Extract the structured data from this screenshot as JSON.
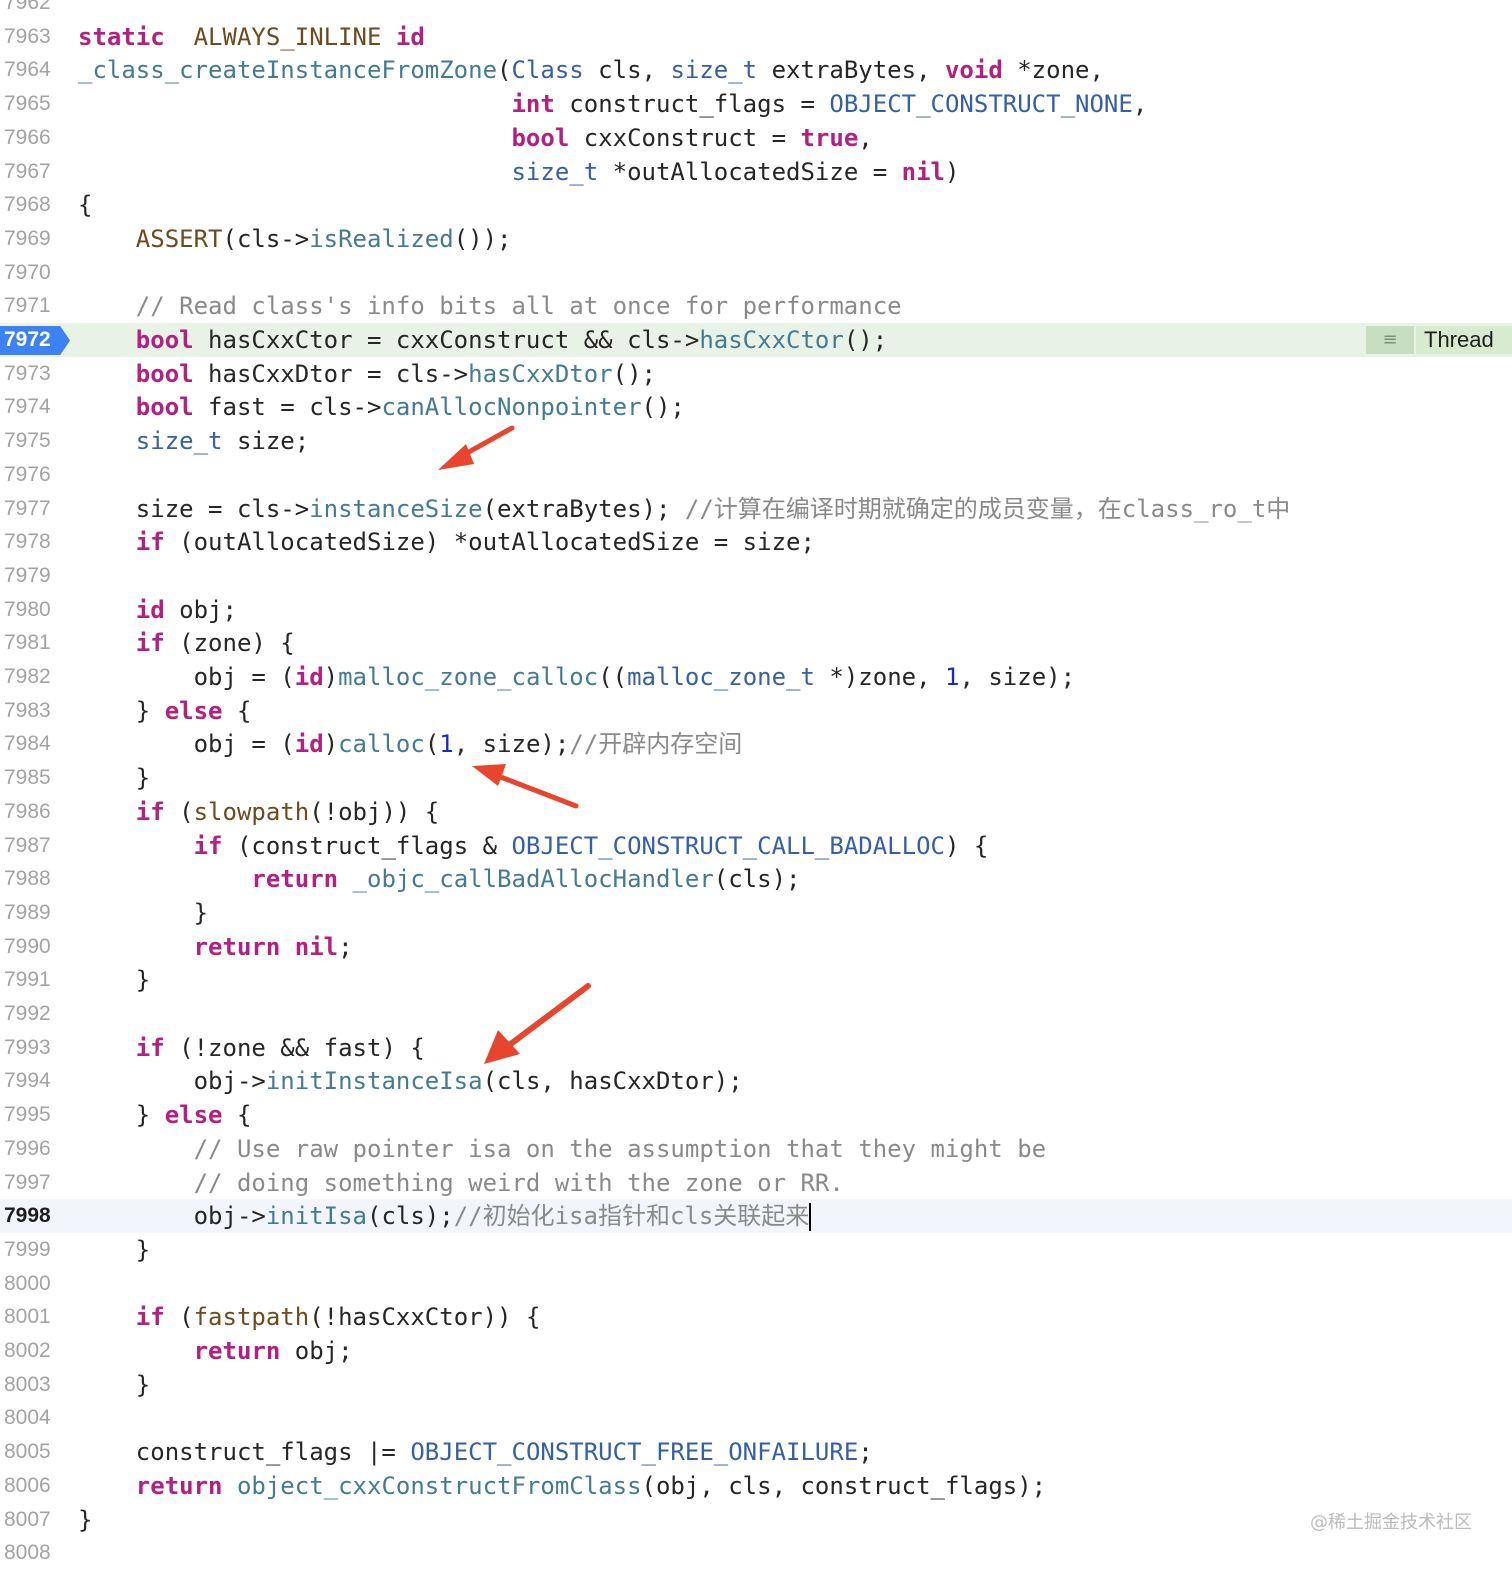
{
  "editor": {
    "lines": [
      {
        "num": "7962",
        "tokens": []
      },
      {
        "num": "7963",
        "tokens": [
          [
            "k",
            "static"
          ],
          [
            "",
            "  "
          ],
          [
            "m",
            "ALWAYS_INLINE"
          ],
          [
            "",
            ""
          ],
          [
            "k",
            " id"
          ]
        ]
      },
      {
        "num": "7964",
        "tokens": [
          [
            "f",
            "_class_createInstanceFromZone"
          ],
          [
            "",
            "("
          ],
          [
            "t",
            "Class"
          ],
          [
            "",
            " cls, "
          ],
          [
            "t",
            "size_t"
          ],
          [
            "",
            " extraBytes, "
          ],
          [
            "k",
            "void"
          ],
          [
            "",
            " *zone,"
          ]
        ]
      },
      {
        "num": "7965",
        "tokens": [
          [
            "",
            "                              "
          ],
          [
            "k",
            "int"
          ],
          [
            "",
            " construct_flags = "
          ],
          [
            "t",
            "OBJECT_CONSTRUCT_NONE"
          ],
          [
            "",
            ","
          ]
        ]
      },
      {
        "num": "7966",
        "tokens": [
          [
            "",
            "                              "
          ],
          [
            "k",
            "bool"
          ],
          [
            "",
            " cxxConstruct = "
          ],
          [
            "k",
            "true"
          ],
          [
            "",
            ","
          ]
        ]
      },
      {
        "num": "7967",
        "tokens": [
          [
            "",
            "                              "
          ],
          [
            "t",
            "size_t"
          ],
          [
            "",
            " *outAllocatedSize = "
          ],
          [
            "k",
            "nil"
          ],
          [
            "",
            ")"
          ]
        ]
      },
      {
        "num": "7968",
        "tokens": [
          [
            "",
            "{"
          ]
        ]
      },
      {
        "num": "7969",
        "tokens": [
          [
            "",
            "    "
          ],
          [
            "m",
            "ASSERT"
          ],
          [
            "",
            "(cls->"
          ],
          [
            "f",
            "isRealized"
          ],
          [
            "",
            "());"
          ]
        ]
      },
      {
        "num": "7970",
        "tokens": []
      },
      {
        "num": "7971",
        "tokens": [
          [
            "",
            "    "
          ],
          [
            "c",
            "// Read class's info bits all at once for performance"
          ]
        ]
      },
      {
        "num": "7972",
        "tokens": [
          [
            "",
            "    "
          ],
          [
            "k",
            "bool"
          ],
          [
            "",
            " hasCxxCtor = cxxConstruct && cls->"
          ],
          [
            "f",
            "hasCxxCtor"
          ],
          [
            "",
            "();"
          ]
        ]
      },
      {
        "num": "7973",
        "tokens": [
          [
            "",
            "    "
          ],
          [
            "k",
            "bool"
          ],
          [
            "",
            " hasCxxDtor = cls->"
          ],
          [
            "f",
            "hasCxxDtor"
          ],
          [
            "",
            "();"
          ]
        ]
      },
      {
        "num": "7974",
        "tokens": [
          [
            "",
            "    "
          ],
          [
            "k",
            "bool"
          ],
          [
            "",
            " fast = cls->"
          ],
          [
            "f",
            "canAllocNonpointer"
          ],
          [
            "",
            "();"
          ]
        ]
      },
      {
        "num": "7975",
        "tokens": [
          [
            "",
            "    "
          ],
          [
            "t",
            "size_t"
          ],
          [
            "",
            " size;"
          ]
        ]
      },
      {
        "num": "7976",
        "tokens": []
      },
      {
        "num": "7977",
        "tokens": [
          [
            "",
            "    size = cls->"
          ],
          [
            "f",
            "instanceSize"
          ],
          [
            "",
            "(extraBytes); "
          ],
          [
            "c",
            "//计算在编译时期就确定的成员变量，在class_ro_t中"
          ]
        ]
      },
      {
        "num": "7978",
        "tokens": [
          [
            "",
            "    "
          ],
          [
            "k",
            "if"
          ],
          [
            "",
            " (outAllocatedSize) *outAllocatedSize = size;"
          ]
        ]
      },
      {
        "num": "7979",
        "tokens": []
      },
      {
        "num": "7980",
        "tokens": [
          [
            "",
            "    "
          ],
          [
            "k",
            "id"
          ],
          [
            "",
            " obj;"
          ]
        ]
      },
      {
        "num": "7981",
        "tokens": [
          [
            "",
            "    "
          ],
          [
            "k",
            "if"
          ],
          [
            "",
            " (zone) {"
          ]
        ]
      },
      {
        "num": "7982",
        "tokens": [
          [
            "",
            "        obj = ("
          ],
          [
            "k",
            "id"
          ],
          [
            "",
            ")"
          ],
          [
            "f",
            "malloc_zone_calloc"
          ],
          [
            "",
            "(("
          ],
          [
            "t",
            "malloc_zone_t"
          ],
          [
            "",
            " *)zone, "
          ],
          [
            "n",
            "1"
          ],
          [
            "",
            ", size);"
          ]
        ]
      },
      {
        "num": "7983",
        "tokens": [
          [
            "",
            "    } "
          ],
          [
            "k",
            "else"
          ],
          [
            "",
            " {"
          ]
        ]
      },
      {
        "num": "7984",
        "tokens": [
          [
            "",
            "        obj = ("
          ],
          [
            "k",
            "id"
          ],
          [
            "",
            ")"
          ],
          [
            "f",
            "calloc"
          ],
          [
            "",
            "("
          ],
          [
            "n",
            "1"
          ],
          [
            "",
            ", size);"
          ],
          [
            "c",
            "//开辟内存空间"
          ]
        ]
      },
      {
        "num": "7985",
        "tokens": [
          [
            "",
            "    }"
          ]
        ]
      },
      {
        "num": "7986",
        "tokens": [
          [
            "",
            "    "
          ],
          [
            "k",
            "if"
          ],
          [
            "",
            " ("
          ],
          [
            "m",
            "slowpath"
          ],
          [
            "",
            "(!obj)) {"
          ]
        ]
      },
      {
        "num": "7987",
        "tokens": [
          [
            "",
            "        "
          ],
          [
            "k",
            "if"
          ],
          [
            "",
            " (construct_flags & "
          ],
          [
            "t",
            "OBJECT_CONSTRUCT_CALL_BADALLOC"
          ],
          [
            "",
            ") {"
          ]
        ]
      },
      {
        "num": "7988",
        "tokens": [
          [
            "",
            "            "
          ],
          [
            "k",
            "return"
          ],
          [
            "",
            " "
          ],
          [
            "f",
            "_objc_callBadAllocHandler"
          ],
          [
            "",
            "(cls);"
          ]
        ]
      },
      {
        "num": "7989",
        "tokens": [
          [
            "",
            "        }"
          ]
        ]
      },
      {
        "num": "7990",
        "tokens": [
          [
            "",
            "        "
          ],
          [
            "k",
            "return"
          ],
          [
            "",
            " "
          ],
          [
            "k",
            "nil"
          ],
          [
            "",
            ";"
          ]
        ]
      },
      {
        "num": "7991",
        "tokens": [
          [
            "",
            "    }"
          ]
        ]
      },
      {
        "num": "7992",
        "tokens": []
      },
      {
        "num": "7993",
        "tokens": [
          [
            "",
            "    "
          ],
          [
            "k",
            "if"
          ],
          [
            "",
            " (!zone && fast) {"
          ]
        ]
      },
      {
        "num": "7994",
        "tokens": [
          [
            "",
            "        obj->"
          ],
          [
            "f",
            "initInstanceIsa"
          ],
          [
            "",
            "(cls, hasCxxDtor);"
          ]
        ]
      },
      {
        "num": "7995",
        "tokens": [
          [
            "",
            "    } "
          ],
          [
            "k",
            "else"
          ],
          [
            "",
            " {"
          ]
        ]
      },
      {
        "num": "7996",
        "tokens": [
          [
            "",
            "        "
          ],
          [
            "c",
            "// Use raw pointer isa on the assumption that they might be"
          ]
        ]
      },
      {
        "num": "7997",
        "tokens": [
          [
            "",
            "        "
          ],
          [
            "c",
            "// doing something weird with the zone or RR."
          ]
        ]
      },
      {
        "num": "7998",
        "tokens": [
          [
            "",
            "        obj->"
          ],
          [
            "f",
            "initIsa"
          ],
          [
            "",
            "(cls);"
          ],
          [
            "c",
            "//初始化isa指针和cls关联起来"
          ]
        ]
      },
      {
        "num": "7999",
        "tokens": [
          [
            "",
            "    }"
          ]
        ]
      },
      {
        "num": "8000",
        "tokens": []
      },
      {
        "num": "8001",
        "tokens": [
          [
            "",
            "    "
          ],
          [
            "k",
            "if"
          ],
          [
            "",
            " ("
          ],
          [
            "m",
            "fastpath"
          ],
          [
            "",
            "(!hasCxxCtor)) {"
          ]
        ]
      },
      {
        "num": "8002",
        "tokens": [
          [
            "",
            "        "
          ],
          [
            "k",
            "return"
          ],
          [
            "",
            " obj;"
          ]
        ]
      },
      {
        "num": "8003",
        "tokens": [
          [
            "",
            "    }"
          ]
        ]
      },
      {
        "num": "8004",
        "tokens": []
      },
      {
        "num": "8005",
        "tokens": [
          [
            "",
            "    construct_flags |= "
          ],
          [
            "t",
            "OBJECT_CONSTRUCT_FREE_ONFAILURE"
          ],
          [
            "",
            ";"
          ]
        ]
      },
      {
        "num": "8006",
        "tokens": [
          [
            "",
            "    "
          ],
          [
            "k",
            "return"
          ],
          [
            "",
            " "
          ],
          [
            "f",
            "object_cxxConstructFromClass"
          ],
          [
            "",
            "(obj, cls, construct_flags);"
          ]
        ]
      },
      {
        "num": "8007",
        "tokens": [
          [
            "",
            "}"
          ]
        ]
      },
      {
        "num": "8008",
        "tokens": []
      }
    ],
    "current_line": "7972",
    "cursor_line": "7998",
    "thread_badge": {
      "icon": "list-icon",
      "label": "Thread"
    }
  },
  "watermark": "@稀土掘金技术社区",
  "colors": {
    "keyword": "#b3207f",
    "type": "#3660a6",
    "function": "#447b92",
    "macro": "#6e4a1f",
    "comment": "#8a8a8a",
    "number": "#1b27c8",
    "arrow": "#e8452f",
    "current_line_bg": "#e8f2e6",
    "line_badge": "#3c82f5"
  }
}
